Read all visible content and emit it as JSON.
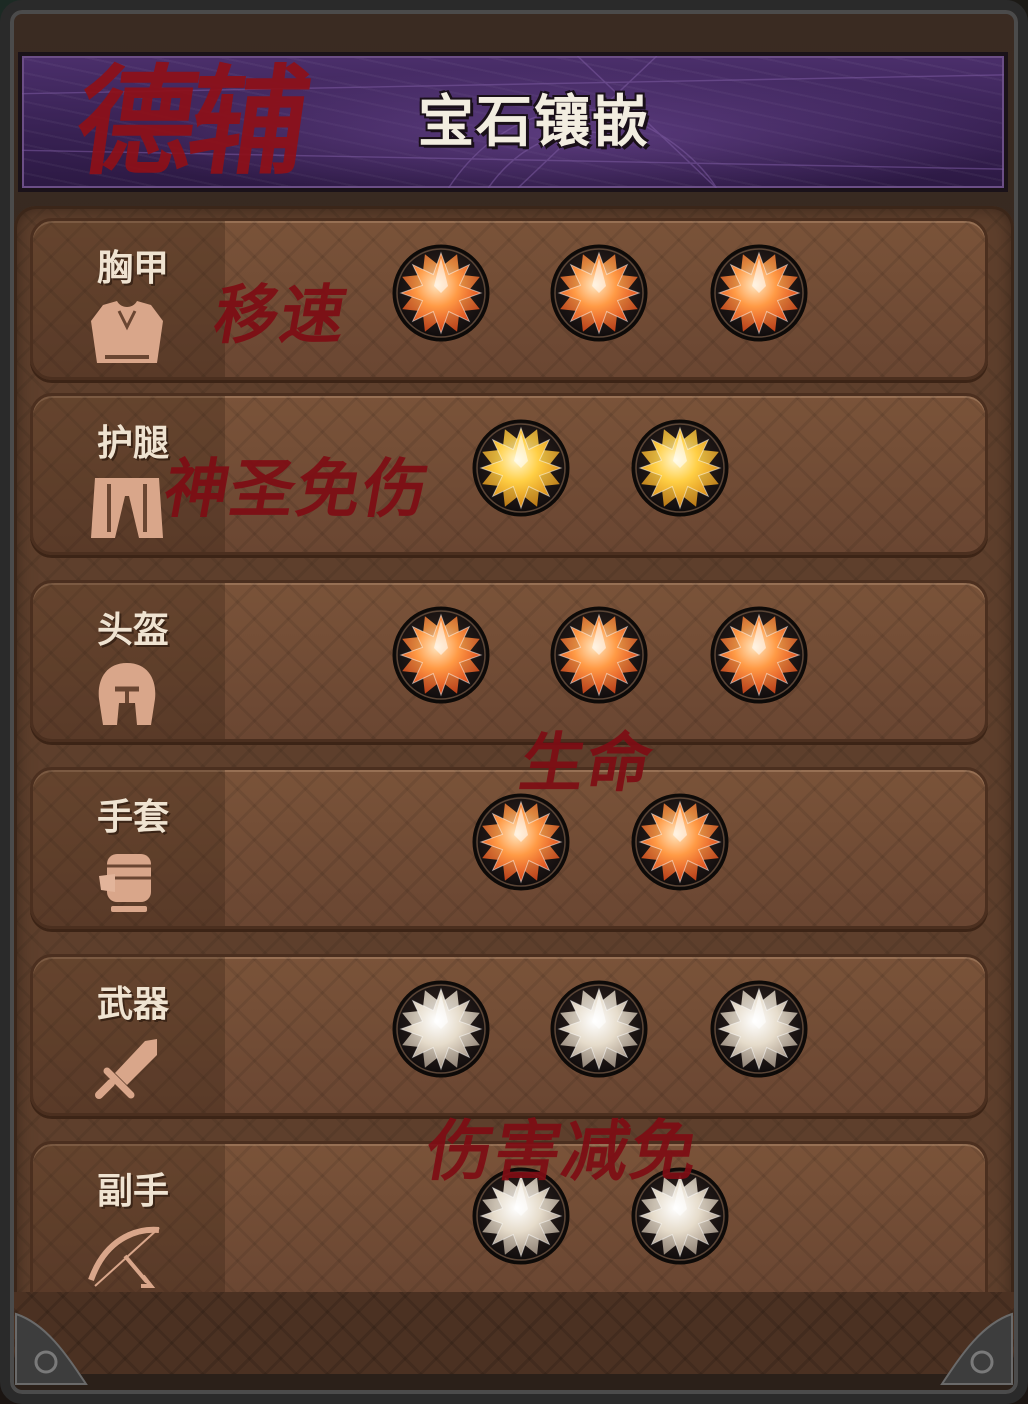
{
  "header": {
    "title": "宝石镶嵌",
    "brand_mark": "德辅"
  },
  "rows": [
    {
      "label": "胸甲",
      "icon": "chestplate-icon",
      "gem_color": "orange",
      "gem_count": 3
    },
    {
      "label": "护腿",
      "icon": "leggings-icon",
      "gem_color": "gold",
      "gem_count": 2
    },
    {
      "label": "头盔",
      "icon": "helmet-icon",
      "gem_color": "orange",
      "gem_count": 3
    },
    {
      "label": "手套",
      "icon": "gloves-fist-icon",
      "gem_color": "orange",
      "gem_count": 2
    },
    {
      "label": "武器",
      "icon": "sword-icon",
      "gem_color": "silver",
      "gem_count": 3
    },
    {
      "label": "副手",
      "icon": "bow-offhand-icon",
      "gem_color": "silver",
      "gem_count": 2
    }
  ],
  "annotations": {
    "chest": "移速",
    "legs": "神圣免伤",
    "head_gloves": "生命",
    "weapon_offhand": "伤害减免"
  },
  "colors": {
    "header_purple": "#3a2356",
    "panel_brown": "#5e3f2c",
    "row_brown": "#7a5339",
    "annotation_red": "#7e0d14",
    "gem_orange": "#ff7a2a",
    "gem_gold": "#ffc233",
    "gem_silver": "#e3d8c6"
  }
}
